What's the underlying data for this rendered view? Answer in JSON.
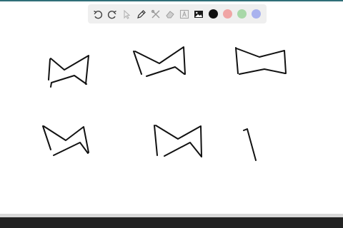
{
  "toolbar": {
    "tools": [
      {
        "name": "undo-icon"
      },
      {
        "name": "redo-icon"
      },
      {
        "name": "pointer-icon"
      },
      {
        "name": "pen-icon"
      },
      {
        "name": "tools-icon"
      },
      {
        "name": "eraser-icon"
      },
      {
        "name": "text-icon"
      },
      {
        "name": "image-icon"
      }
    ],
    "colors": [
      "#111111",
      "#f0a5a5",
      "#a8d8a8",
      "#a9b2ee"
    ],
    "selected_color": "#111111"
  },
  "canvas": {
    "stroke_color": "#111111",
    "stroke_count": 6
  },
  "colors": {
    "top_edge": "#2f6f78",
    "bottom_bar": "#222222"
  }
}
